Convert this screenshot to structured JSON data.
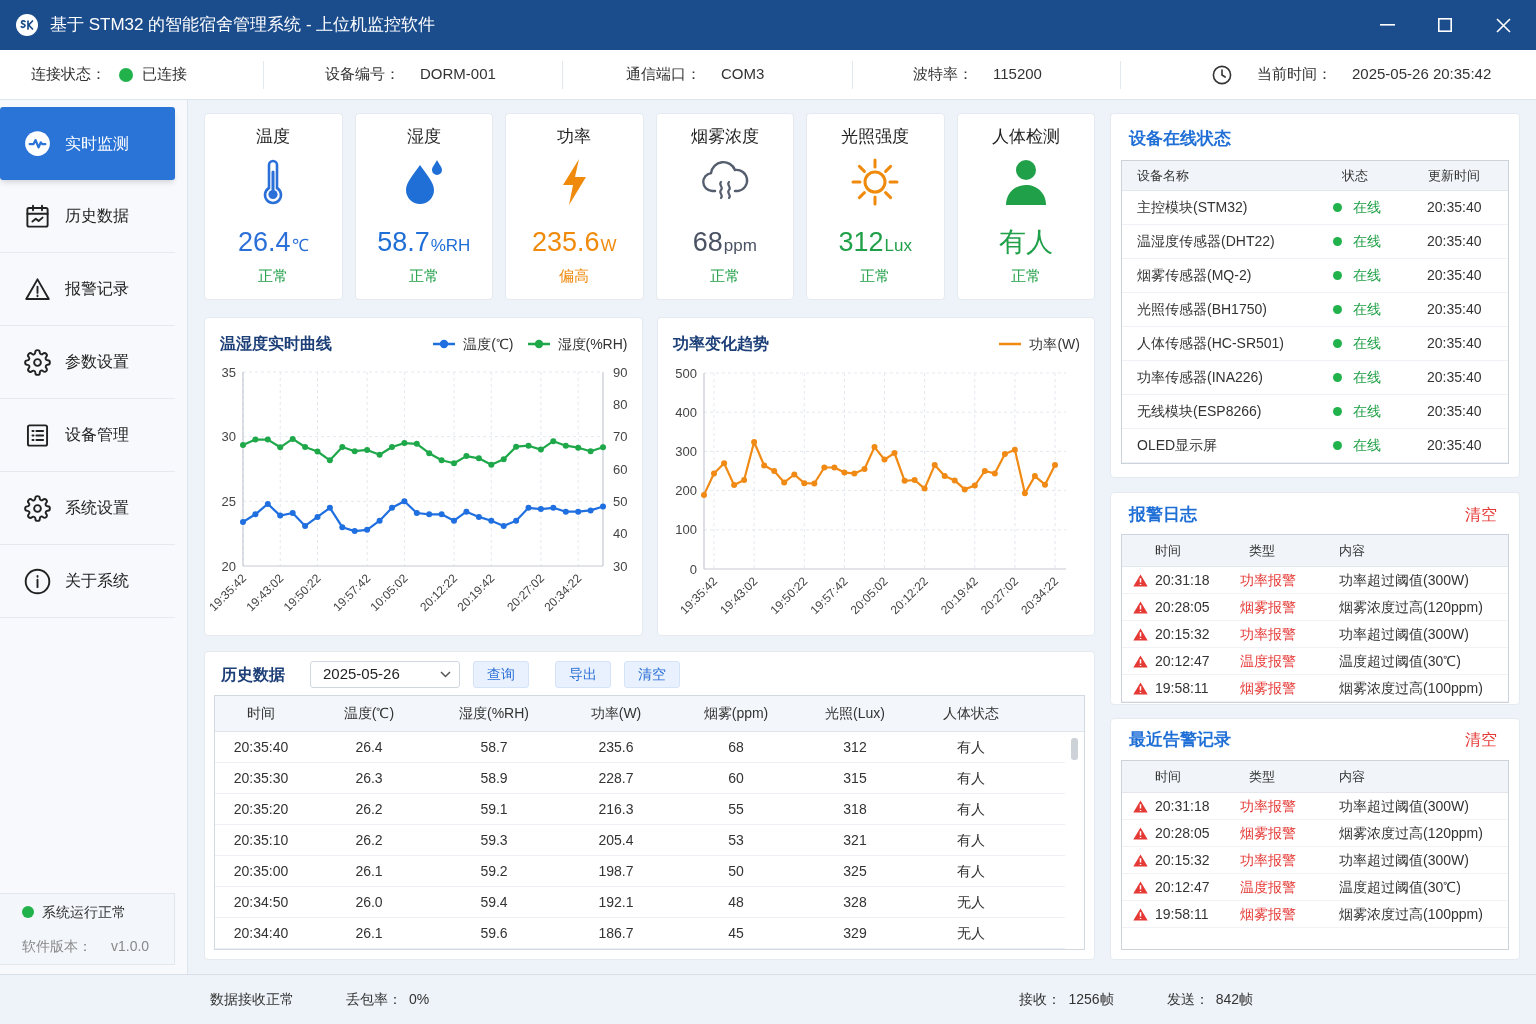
{
  "window": {
    "title": "基于 STM32 的智能宿舍管理系统 - 上位机监控软件"
  },
  "info_bar": {
    "items": [
      {
        "kind": "connection",
        "label": "连接状态：",
        "value": "已连接",
        "connected": true
      },
      {
        "kind": "field",
        "label": "设备编号：",
        "value": "DORM-001"
      },
      {
        "kind": "field",
        "label": "通信端口：",
        "value": "COM3"
      },
      {
        "kind": "field",
        "label": "波特率：",
        "value": "115200"
      },
      {
        "kind": "clock",
        "label": "当前时间：",
        "value": "2025-05-26 20:35:42"
      }
    ]
  },
  "sidebar": {
    "items": [
      {
        "label": "实时监测",
        "selected": true
      },
      {
        "label": "历史数据",
        "selected": false
      },
      {
        "label": "报警记录",
        "selected": false
      },
      {
        "label": "参数设置",
        "selected": false
      },
      {
        "label": "设备管理",
        "selected": false
      },
      {
        "label": "系统设置",
        "selected": false
      },
      {
        "label": "关于系统",
        "selected": false
      }
    ],
    "system_status": {
      "label": "系统运行正常",
      "ok": true,
      "version_label": "软件版本：",
      "version": "v1.0.0"
    }
  },
  "sensors": [
    {
      "title": "温度",
      "value": "26.4",
      "unit": "℃",
      "status": "正常",
      "alert": false,
      "color": "#2b6fd8"
    },
    {
      "title": "湿度",
      "value": "58.7",
      "unit": "%RH",
      "status": "正常",
      "alert": false,
      "color": "#1f6fd6"
    },
    {
      "title": "功率",
      "value": "235.6",
      "unit": "W",
      "status": "偏高",
      "alert": true,
      "color": "#f08a0c"
    },
    {
      "title": "烟雾浓度",
      "value": "68",
      "unit": "ppm",
      "status": "正常",
      "alert": false,
      "color": "#4a5263"
    },
    {
      "title": "光照强度",
      "value": "312",
      "unit": "Lux",
      "status": "正常",
      "alert": false,
      "color": "#21a04a"
    },
    {
      "title": "人体检测",
      "value": "有人",
      "status": "正常",
      "alert": false,
      "color": "#21a04a"
    }
  ],
  "temp_humidity_chart": {
    "legend_markers": true,
    "chart_data": {
      "type": "line",
      "title": "温湿度实时曲线",
      "grid": true,
      "categories": [
        "19:35:42",
        null,
        null,
        "19:43:02",
        null,
        null,
        "19:50:22",
        null,
        null,
        null,
        "19:57:42",
        null,
        null,
        "10:05:02",
        null,
        null,
        null,
        "20:12:22",
        null,
        null,
        "20:19:42",
        null,
        null,
        null,
        "20:27:02",
        null,
        null,
        "20:34:22",
        null,
        null
      ],
      "series": [
        {
          "name": "温度(℃)",
          "color": "#1f6fe0",
          "marker": "circle",
          "values": [
            23.4,
            24.0,
            24.8,
            23.9,
            24.1,
            23.1,
            23.8,
            24.5,
            23.0,
            22.7,
            22.8,
            23.5,
            24.5,
            25.0,
            24.1,
            24.0,
            24.0,
            23.5,
            24.2,
            23.8,
            23.5,
            23.1,
            23.5,
            24.5,
            24.4,
            24.5,
            24.2,
            24.2,
            24.3,
            24.6
          ]
        },
        {
          "name": "湿度(%RH)",
          "color": "#1ea84a",
          "axis": "y2",
          "marker": "circle",
          "values": [
            67.4,
            69.1,
            69.1,
            66.7,
            69.3,
            66.8,
            65.4,
            62.7,
            66.8,
            65.5,
            65.9,
            64.4,
            66.8,
            68.0,
            67.8,
            64.9,
            62.7,
            61.8,
            64.0,
            63.3,
            61.3,
            63.0,
            66.9,
            67.2,
            66.0,
            68.6,
            67.2,
            66.6,
            65.5,
            66.7
          ]
        }
      ],
      "ylim": [
        20,
        35
      ],
      "yticks": [
        20,
        25,
        30,
        35
      ],
      "y2lim": [
        30,
        90
      ],
      "y2ticks": [
        30,
        40,
        50,
        60,
        70,
        80,
        90
      ]
    }
  },
  "power_chart": {
    "legend_markers": false,
    "chart_data": {
      "type": "line",
      "title": "功率变化趋势",
      "grid": true,
      "categories": [
        null,
        "19:35:42",
        null,
        null,
        null,
        "19:43:02",
        null,
        null,
        null,
        null,
        "19:50:22",
        null,
        null,
        null,
        "19:57:42",
        null,
        null,
        null,
        "20:05:02",
        null,
        null,
        null,
        "20:12:22",
        null,
        null,
        null,
        null,
        "20:19:42",
        null,
        null,
        null,
        "20:27:02",
        null,
        null,
        null,
        "20:34:22"
      ],
      "series": [
        {
          "name": "功率(W)",
          "color": "#f08a14",
          "marker": "circle",
          "values": [
            189,
            244,
            270,
            214,
            227,
            324,
            264,
            250,
            221,
            241,
            219,
            218,
            259,
            259,
            246,
            244,
            255,
            311,
            279,
            296,
            225,
            227,
            205,
            265,
            237,
            226,
            203,
            213,
            250,
            244,
            293,
            304,
            193,
            237,
            215,
            265
          ]
        }
      ],
      "ylim": [
        0,
        500
      ],
      "yticks": [
        0,
        100,
        200,
        300,
        400,
        500
      ]
    }
  },
  "history": {
    "title": "历史数据",
    "date": "2025-05-26",
    "buttons": [
      "查询",
      "导出",
      "清空"
    ],
    "columns": [
      "时间",
      "温度(℃)",
      "湿度(%RH)",
      "功率(W)",
      "烟雾(ppm)",
      "光照(Lux)",
      "人体状态"
    ],
    "rows": [
      [
        "20:35:40",
        "26.4",
        "58.7",
        "235.6",
        "68",
        "312",
        "有人"
      ],
      [
        "20:35:30",
        "26.3",
        "58.9",
        "228.7",
        "60",
        "315",
        "有人"
      ],
      [
        "20:35:20",
        "26.2",
        "59.1",
        "216.3",
        "55",
        "318",
        "有人"
      ],
      [
        "20:35:10",
        "26.2",
        "59.3",
        "205.4",
        "53",
        "321",
        "有人"
      ],
      [
        "20:35:00",
        "26.1",
        "59.2",
        "198.7",
        "50",
        "325",
        "有人"
      ],
      [
        "20:34:50",
        "26.0",
        "59.4",
        "192.1",
        "48",
        "328",
        "无人"
      ],
      [
        "20:34:40",
        "26.1",
        "59.6",
        "186.7",
        "45",
        "329",
        "无人"
      ]
    ]
  },
  "devices": {
    "title": "设备在线状态",
    "columns": [
      "设备名称",
      "状态",
      "更新时间"
    ],
    "rows": [
      {
        "name": "主控模块(STM32)",
        "status": "在线",
        "online": true,
        "time": "20:35:40"
      },
      {
        "name": "温湿度传感器(DHT22)",
        "status": "在线",
        "online": true,
        "time": "20:35:40"
      },
      {
        "name": "烟雾传感器(MQ-2)",
        "status": "在线",
        "online": true,
        "time": "20:35:40"
      },
      {
        "name": "光照传感器(BH1750)",
        "status": "在线",
        "online": true,
        "time": "20:35:40"
      },
      {
        "name": "人体传感器(HC-SR501)",
        "status": "在线",
        "online": true,
        "time": "20:35:40"
      },
      {
        "name": "功率传感器(INA226)",
        "status": "在线",
        "online": true,
        "time": "20:35:40"
      },
      {
        "name": "无线模块(ESP8266)",
        "status": "在线",
        "online": true,
        "time": "20:35:40"
      },
      {
        "name": "OLED显示屏",
        "status": "在线",
        "online": true,
        "time": "20:35:40"
      }
    ]
  },
  "alarm_log": {
    "title": "报警日志",
    "clear": "清空",
    "columns": [
      "时间",
      "类型",
      "内容"
    ],
    "rows": [
      {
        "time": "20:31:18",
        "type": "功率报警",
        "content": "功率超过阈值(300W)"
      },
      {
        "time": "20:28:05",
        "type": "烟雾报警",
        "content": "烟雾浓度过高(120ppm)"
      },
      {
        "time": "20:15:32",
        "type": "功率报警",
        "content": "功率超过阈值(300W)"
      },
      {
        "time": "20:12:47",
        "type": "温度报警",
        "content": "温度超过阈值(30℃)"
      },
      {
        "time": "19:58:11",
        "type": "烟雾报警",
        "content": "烟雾浓度过高(100ppm)"
      }
    ]
  },
  "recent_alarms": {
    "title": "最近告警记录",
    "clear": "清空",
    "columns": [
      "时间",
      "类型",
      "内容"
    ],
    "rows": [
      {
        "time": "20:31:18",
        "type": "功率报警",
        "content": "功率超过阈值(300W)"
      },
      {
        "time": "20:28:05",
        "type": "烟雾报警",
        "content": "烟雾浓度过高(120ppm)"
      },
      {
        "time": "20:15:32",
        "type": "功率报警",
        "content": "功率超过阈值(300W)"
      },
      {
        "time": "20:12:47",
        "type": "温度报警",
        "content": "温度超过阈值(30℃)"
      },
      {
        "time": "19:58:11",
        "type": "烟雾报警",
        "content": "烟雾浓度过高(100ppm)"
      }
    ]
  },
  "status_bar": {
    "left": [
      {
        "label": "数据接收正常"
      },
      {
        "label": "丢包率：",
        "value": "0%"
      }
    ],
    "right": [
      {
        "label": "接收：",
        "value": "1256帧"
      },
      {
        "label": "发送：",
        "value": "842帧"
      }
    ]
  }
}
